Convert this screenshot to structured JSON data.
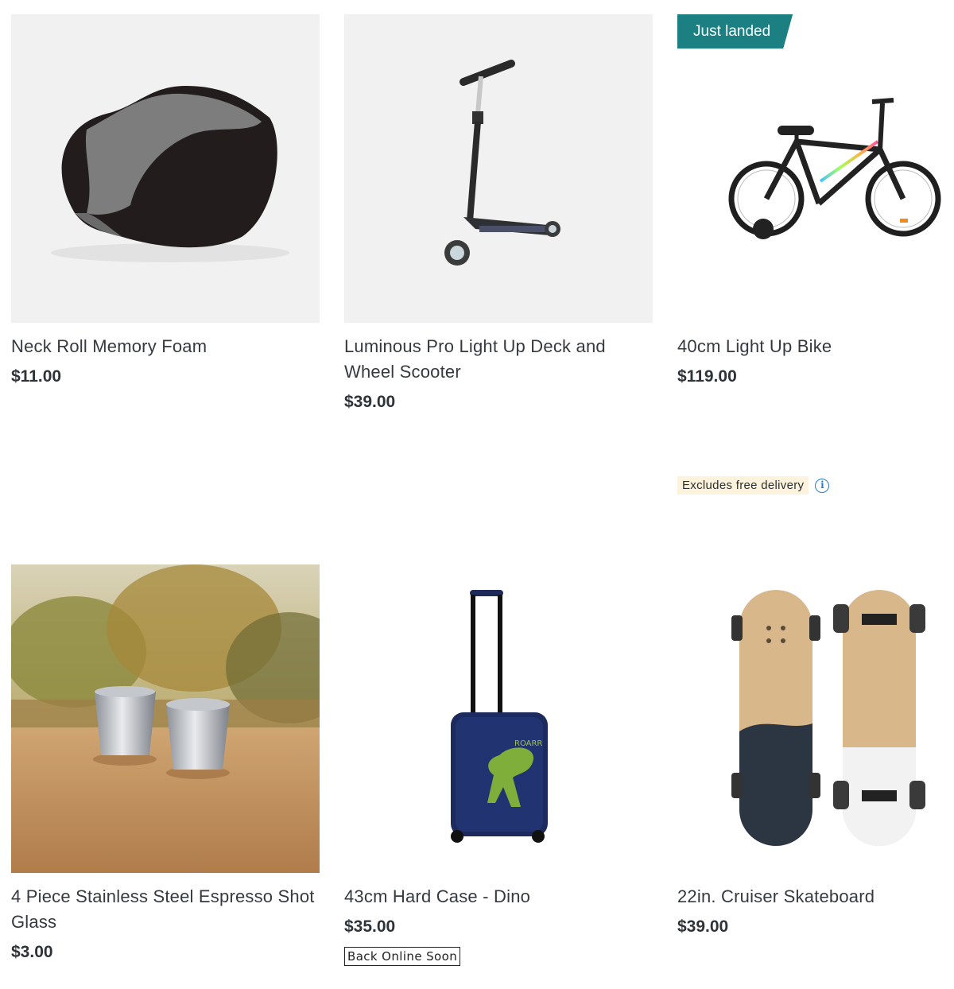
{
  "products": [
    {
      "title": "Neck Roll Memory Foam",
      "price": "$11.00",
      "image": "neck-pillow"
    },
    {
      "title": "Luminous Pro Light Up Deck and Wheel Scooter",
      "price": "$39.00",
      "image": "scooter"
    },
    {
      "title": "40cm Light Up Bike",
      "price": "$119.00",
      "image": "bike",
      "badge": "Just landed",
      "notice": "Excludes free delivery"
    },
    {
      "title": "4 Piece Stainless Steel Espresso Shot Glass",
      "price": "$3.00",
      "image": "espresso-cups"
    },
    {
      "title": "43cm Hard Case - Dino",
      "price": "$35.00",
      "image": "dino-suitcase",
      "status": "Back Online Soon"
    },
    {
      "title": "22in. Cruiser Skateboard",
      "price": "$39.00",
      "image": "skateboard"
    }
  ],
  "colors": {
    "badge": "#1c7f82",
    "notice_bg": "#fdf3dc",
    "info": "#2a7dc7"
  }
}
